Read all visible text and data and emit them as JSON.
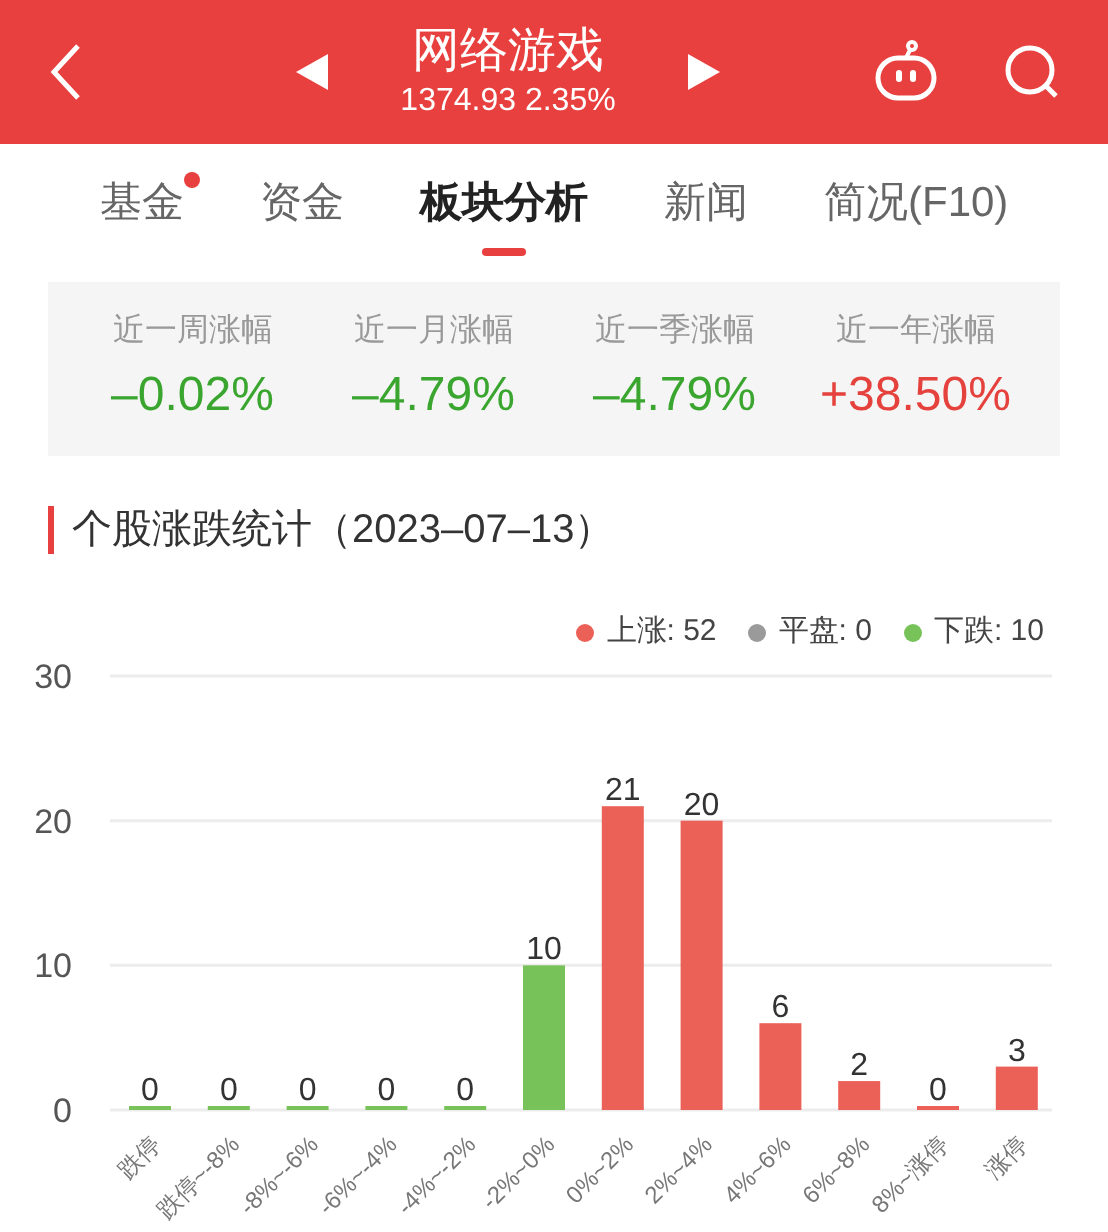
{
  "header": {
    "title": "网络游戏",
    "index_value": "1374.93 2.35%"
  },
  "tabs": [
    {
      "label": "基金",
      "selected": false,
      "badge": true
    },
    {
      "label": "资金",
      "selected": false,
      "badge": false
    },
    {
      "label": "板块分析",
      "selected": true,
      "badge": false
    },
    {
      "label": "新闻",
      "selected": false,
      "badge": false
    },
    {
      "label": "简况(F10)",
      "selected": false,
      "badge": false
    }
  ],
  "stats": [
    {
      "label": "近一周涨幅",
      "value": "–0.02%",
      "color": "#3aa62f"
    },
    {
      "label": "近一月涨幅",
      "value": "–4.79%",
      "color": "#3aa62f"
    },
    {
      "label": "近一季涨幅",
      "value": "–4.79%",
      "color": "#3aa62f"
    },
    {
      "label": "近一年涨幅",
      "value": "+38.50%",
      "color": "#e5413d"
    }
  ],
  "section_title": "个股涨跌统计（2023–07–13）",
  "legend": [
    {
      "label": "上涨: 52",
      "color": "#eb6157"
    },
    {
      "label": "平盘: 0",
      "color": "#9a9a9a"
    },
    {
      "label": "下跌: 10",
      "color": "#77c35a"
    }
  ],
  "chart_data": {
    "type": "bar",
    "categories": [
      "跌停",
      "跌停~-8%",
      "-8%~-6%",
      "-6%~-4%",
      "-4%~-2%",
      "-2%~0%",
      "0%~2%",
      "2%~4%",
      "4%~6%",
      "6%~8%",
      "8%~涨停",
      "涨停"
    ],
    "series": [
      {
        "color": "#77c35a",
        "values": [
          0,
          0,
          0,
          0,
          0,
          10,
          null,
          null,
          null,
          null,
          null,
          null
        ]
      },
      {
        "color": "#eb6157",
        "values": [
          null,
          null,
          null,
          null,
          null,
          null,
          21,
          20,
          6,
          2,
          0,
          3
        ]
      }
    ],
    "ylim": [
      0,
      30
    ],
    "yticks": [
      0,
      10,
      20,
      30
    ],
    "data_labels": true
  }
}
